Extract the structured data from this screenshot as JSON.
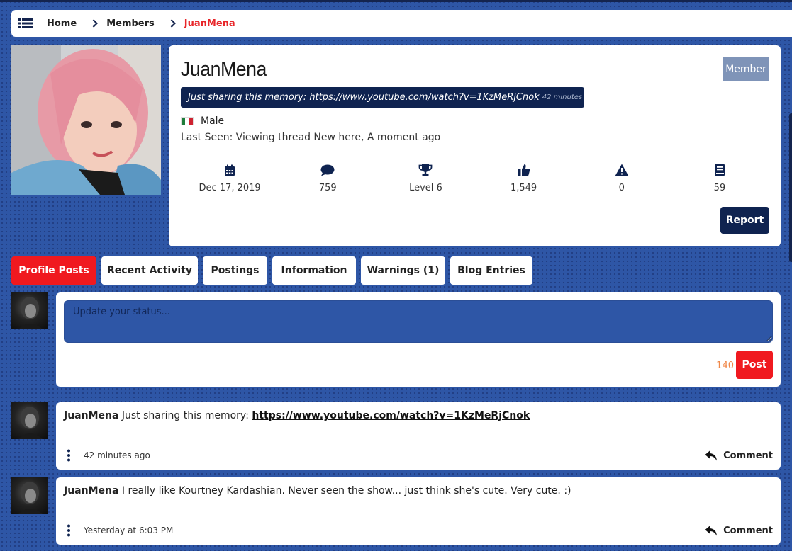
{
  "breadcrumb": {
    "items": [
      "Home",
      "Members"
    ],
    "current": "JuanMena"
  },
  "profile": {
    "username": "JuanMena",
    "badge": "Member",
    "status_text": "Just sharing this memory: https://www.youtube.com/watch?v=1KzMeRjCnok",
    "status_time": "42 minutes ago",
    "gender": "Male",
    "last_seen": "Last Seen: Viewing thread New here, A moment ago",
    "stats": [
      {
        "icon": "calendar-icon",
        "value": "Dec 17, 2019"
      },
      {
        "icon": "chat-bubble-icon",
        "value": "759"
      },
      {
        "icon": "trophy-icon",
        "value": "Level 6"
      },
      {
        "icon": "thumbs-up-icon",
        "value": "1,549"
      },
      {
        "icon": "warning-icon",
        "value": "0"
      },
      {
        "icon": "book-icon",
        "value": "59"
      }
    ],
    "report_label": "Report"
  },
  "tabs": [
    {
      "label": "Profile Posts",
      "active": true
    },
    {
      "label": "Recent Activity",
      "active": false
    },
    {
      "label": "Postings",
      "active": false
    },
    {
      "label": "Information",
      "active": false
    },
    {
      "label": "Warnings (1)",
      "active": false
    },
    {
      "label": "Blog Entries",
      "active": false
    }
  ],
  "composer": {
    "placeholder": "Update your status...",
    "char_count": "140",
    "post_label": "Post"
  },
  "posts": [
    {
      "author": "JuanMena",
      "text": "Just sharing this memory:",
      "link": "https://www.youtube.com/watch?v=1KzMeRjCnok",
      "time": "42 minutes ago",
      "comment_label": "Comment"
    },
    {
      "author": "JuanMena",
      "text": "I really like Kourtney Kardashian. Never seen the show... just think she's cute. Very cute. :)",
      "link": "",
      "time": "Yesterday at 6:03 PM",
      "comment_label": "Comment"
    }
  ],
  "colors": {
    "background": "#2e56a6",
    "navy": "#0f2350",
    "accent_red": "#f0191f",
    "badge_gray": "#7f94b8",
    "char_count_orange": "#f0884a"
  }
}
